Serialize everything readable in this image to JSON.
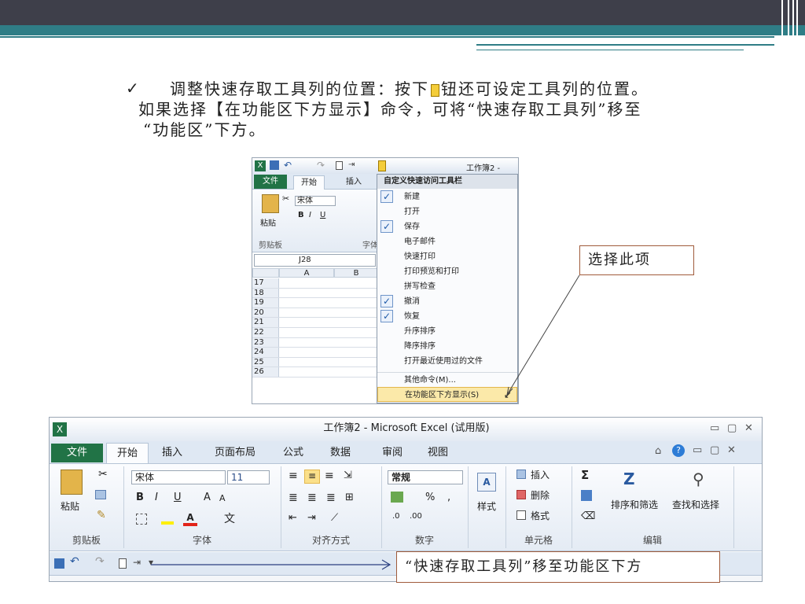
{
  "bullet": {
    "mark": "✓",
    "line1": "调整快速存取工具列的位置：按下",
    "line1b": "钮还可设定工具列的位置。",
    "line2": "如果选择【在功能区下方显示】命令，可将“快速存取工具列”移至",
    "line3": "“功能区”下方。"
  },
  "small_shot": {
    "title": "工作簿2 -",
    "tabs": [
      "文件",
      "开始",
      "插入"
    ],
    "font_name": "宋体",
    "paste_label": "粘贴",
    "group_clipboard": "剪贴板",
    "group_font_partial": "字体",
    "namebox": "J28",
    "columns": [
      "A",
      "B"
    ],
    "rows": [
      "17",
      "18",
      "19",
      "20",
      "21",
      "22",
      "23",
      "24",
      "25",
      "26"
    ],
    "menu": {
      "title": "自定义快速访问工具栏",
      "items": [
        {
          "label": "新建",
          "checked": true
        },
        {
          "label": "打开",
          "checked": false
        },
        {
          "label": "保存",
          "checked": true
        },
        {
          "label": "电子邮件",
          "checked": false
        },
        {
          "label": "快速打印",
          "checked": false
        },
        {
          "label": "打印预览和打印",
          "checked": false
        },
        {
          "label": "拼写检查",
          "checked": false
        },
        {
          "label": "撤消",
          "checked": true
        },
        {
          "label": "恢复",
          "checked": true
        },
        {
          "label": "升序排序",
          "checked": false
        },
        {
          "label": "降序排序",
          "checked": false
        },
        {
          "label": "打开最近使用过的文件",
          "checked": false
        },
        {
          "label": "其他命令(M)...",
          "checked": false
        },
        {
          "label": "在功能区下方显示(S)",
          "checked": false,
          "highlighted": true
        }
      ]
    }
  },
  "callout1": "选择此项",
  "big_shot": {
    "title": "工作簿2 - Microsoft Excel (试用版)",
    "tabs": [
      "文件",
      "开始",
      "插入",
      "页面布局",
      "公式",
      "数据",
      "审阅",
      "视图"
    ],
    "paste_label": "粘贴",
    "font_name": "宋体",
    "font_size": "11",
    "number_format": "常规",
    "style_label": "样式",
    "insert_label": "插入",
    "delete_label": "删除",
    "format_label": "格式",
    "sort_filter_label": "排序和筛选",
    "find_select_label": "查找和选择",
    "groups": [
      "剪贴板",
      "字体",
      "对齐方式",
      "数字",
      "单元格",
      "编辑"
    ]
  },
  "callout2": "“快速存取工具列”移至功能区下方",
  "colors": {
    "excel_green": "#217346",
    "teal": "#2f7d86",
    "dark": "#3e3f4a"
  }
}
